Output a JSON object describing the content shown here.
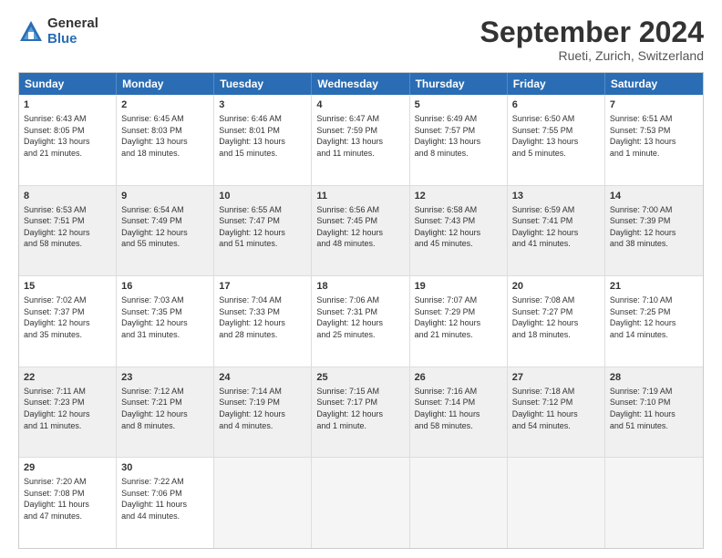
{
  "logo": {
    "general": "General",
    "blue": "Blue"
  },
  "title": "September 2024",
  "location": "Rueti, Zurich, Switzerland",
  "weekdays": [
    "Sunday",
    "Monday",
    "Tuesday",
    "Wednesday",
    "Thursday",
    "Friday",
    "Saturday"
  ],
  "rows": [
    [
      {
        "day": "1",
        "lines": [
          "Sunrise: 6:43 AM",
          "Sunset: 8:05 PM",
          "Daylight: 13 hours",
          "and 21 minutes."
        ]
      },
      {
        "day": "2",
        "lines": [
          "Sunrise: 6:45 AM",
          "Sunset: 8:03 PM",
          "Daylight: 13 hours",
          "and 18 minutes."
        ]
      },
      {
        "day": "3",
        "lines": [
          "Sunrise: 6:46 AM",
          "Sunset: 8:01 PM",
          "Daylight: 13 hours",
          "and 15 minutes."
        ]
      },
      {
        "day": "4",
        "lines": [
          "Sunrise: 6:47 AM",
          "Sunset: 7:59 PM",
          "Daylight: 13 hours",
          "and 11 minutes."
        ]
      },
      {
        "day": "5",
        "lines": [
          "Sunrise: 6:49 AM",
          "Sunset: 7:57 PM",
          "Daylight: 13 hours",
          "and 8 minutes."
        ]
      },
      {
        "day": "6",
        "lines": [
          "Sunrise: 6:50 AM",
          "Sunset: 7:55 PM",
          "Daylight: 13 hours",
          "and 5 minutes."
        ]
      },
      {
        "day": "7",
        "lines": [
          "Sunrise: 6:51 AM",
          "Sunset: 7:53 PM",
          "Daylight: 13 hours",
          "and 1 minute."
        ]
      }
    ],
    [
      {
        "day": "8",
        "lines": [
          "Sunrise: 6:53 AM",
          "Sunset: 7:51 PM",
          "Daylight: 12 hours",
          "and 58 minutes."
        ]
      },
      {
        "day": "9",
        "lines": [
          "Sunrise: 6:54 AM",
          "Sunset: 7:49 PM",
          "Daylight: 12 hours",
          "and 55 minutes."
        ]
      },
      {
        "day": "10",
        "lines": [
          "Sunrise: 6:55 AM",
          "Sunset: 7:47 PM",
          "Daylight: 12 hours",
          "and 51 minutes."
        ]
      },
      {
        "day": "11",
        "lines": [
          "Sunrise: 6:56 AM",
          "Sunset: 7:45 PM",
          "Daylight: 12 hours",
          "and 48 minutes."
        ]
      },
      {
        "day": "12",
        "lines": [
          "Sunrise: 6:58 AM",
          "Sunset: 7:43 PM",
          "Daylight: 12 hours",
          "and 45 minutes."
        ]
      },
      {
        "day": "13",
        "lines": [
          "Sunrise: 6:59 AM",
          "Sunset: 7:41 PM",
          "Daylight: 12 hours",
          "and 41 minutes."
        ]
      },
      {
        "day": "14",
        "lines": [
          "Sunrise: 7:00 AM",
          "Sunset: 7:39 PM",
          "Daylight: 12 hours",
          "and 38 minutes."
        ]
      }
    ],
    [
      {
        "day": "15",
        "lines": [
          "Sunrise: 7:02 AM",
          "Sunset: 7:37 PM",
          "Daylight: 12 hours",
          "and 35 minutes."
        ]
      },
      {
        "day": "16",
        "lines": [
          "Sunrise: 7:03 AM",
          "Sunset: 7:35 PM",
          "Daylight: 12 hours",
          "and 31 minutes."
        ]
      },
      {
        "day": "17",
        "lines": [
          "Sunrise: 7:04 AM",
          "Sunset: 7:33 PM",
          "Daylight: 12 hours",
          "and 28 minutes."
        ]
      },
      {
        "day": "18",
        "lines": [
          "Sunrise: 7:06 AM",
          "Sunset: 7:31 PM",
          "Daylight: 12 hours",
          "and 25 minutes."
        ]
      },
      {
        "day": "19",
        "lines": [
          "Sunrise: 7:07 AM",
          "Sunset: 7:29 PM",
          "Daylight: 12 hours",
          "and 21 minutes."
        ]
      },
      {
        "day": "20",
        "lines": [
          "Sunrise: 7:08 AM",
          "Sunset: 7:27 PM",
          "Daylight: 12 hours",
          "and 18 minutes."
        ]
      },
      {
        "day": "21",
        "lines": [
          "Sunrise: 7:10 AM",
          "Sunset: 7:25 PM",
          "Daylight: 12 hours",
          "and 14 minutes."
        ]
      }
    ],
    [
      {
        "day": "22",
        "lines": [
          "Sunrise: 7:11 AM",
          "Sunset: 7:23 PM",
          "Daylight: 12 hours",
          "and 11 minutes."
        ]
      },
      {
        "day": "23",
        "lines": [
          "Sunrise: 7:12 AM",
          "Sunset: 7:21 PM",
          "Daylight: 12 hours",
          "and 8 minutes."
        ]
      },
      {
        "day": "24",
        "lines": [
          "Sunrise: 7:14 AM",
          "Sunset: 7:19 PM",
          "Daylight: 12 hours",
          "and 4 minutes."
        ]
      },
      {
        "day": "25",
        "lines": [
          "Sunrise: 7:15 AM",
          "Sunset: 7:17 PM",
          "Daylight: 12 hours",
          "and 1 minute."
        ]
      },
      {
        "day": "26",
        "lines": [
          "Sunrise: 7:16 AM",
          "Sunset: 7:14 PM",
          "Daylight: 11 hours",
          "and 58 minutes."
        ]
      },
      {
        "day": "27",
        "lines": [
          "Sunrise: 7:18 AM",
          "Sunset: 7:12 PM",
          "Daylight: 11 hours",
          "and 54 minutes."
        ]
      },
      {
        "day": "28",
        "lines": [
          "Sunrise: 7:19 AM",
          "Sunset: 7:10 PM",
          "Daylight: 11 hours",
          "and 51 minutes."
        ]
      }
    ],
    [
      {
        "day": "29",
        "lines": [
          "Sunrise: 7:20 AM",
          "Sunset: 7:08 PM",
          "Daylight: 11 hours",
          "and 47 minutes."
        ]
      },
      {
        "day": "30",
        "lines": [
          "Sunrise: 7:22 AM",
          "Sunset: 7:06 PM",
          "Daylight: 11 hours",
          "and 44 minutes."
        ]
      },
      {
        "day": "",
        "lines": []
      },
      {
        "day": "",
        "lines": []
      },
      {
        "day": "",
        "lines": []
      },
      {
        "day": "",
        "lines": []
      },
      {
        "day": "",
        "lines": []
      }
    ]
  ]
}
